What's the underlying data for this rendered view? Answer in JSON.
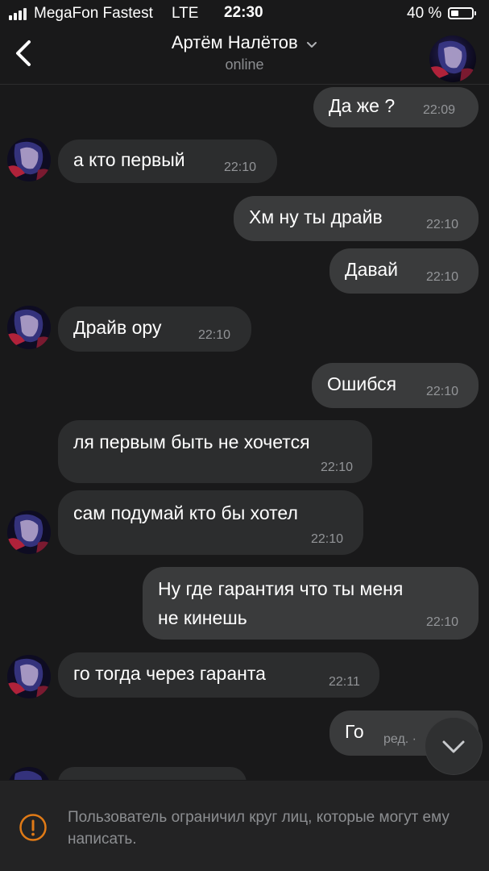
{
  "status_bar": {
    "carrier": "MegaFon Fastest",
    "network": "LTE",
    "time": "22:30",
    "battery_percent": "40 %",
    "battery_level": 0.4
  },
  "header": {
    "name": "Артём Налётов",
    "status": "online"
  },
  "messages": [
    {
      "dir": "out",
      "text": "Да же ?",
      "time": "22:09"
    },
    {
      "dir": "in",
      "text": "а кто первый",
      "time": "22:10",
      "avatar": true
    },
    {
      "dir": "out",
      "text": "Хм ну ты драйв",
      "time": "22:10"
    },
    {
      "dir": "out",
      "text": "Давай",
      "time": "22:10"
    },
    {
      "dir": "in",
      "text": "Драйв ору",
      "time": "22:10",
      "avatar": true
    },
    {
      "dir": "out",
      "text": "Ошибся",
      "time": "22:10"
    },
    {
      "dir": "in",
      "text": "ля первым быть не хочется",
      "time": "22:10"
    },
    {
      "dir": "in",
      "text": "сам подумай кто бы хотел",
      "time": "22:10",
      "avatar": true
    },
    {
      "dir": "out",
      "text_line1": "Ну где гарантия что ты меня",
      "text_line2": "не кинешь",
      "time": "22:10"
    },
    {
      "dir": "in",
      "text": "го тогда через гаранта",
      "time": "22:11",
      "avatar": true
    },
    {
      "dir": "out",
      "text": "Го",
      "time": "ред. ·"
    }
  ],
  "footer": {
    "notice": "Пользователь ограничил круг лиц, которые могут ему написать."
  },
  "colors": {
    "background": "#19191a",
    "bubble_out": "#3a3b3c",
    "bubble_in": "#2c2d2e",
    "warning": "#e64646"
  },
  "icons": [
    "back-icon",
    "chevron-down-icon",
    "scroll-down-icon",
    "warning-icon"
  ]
}
